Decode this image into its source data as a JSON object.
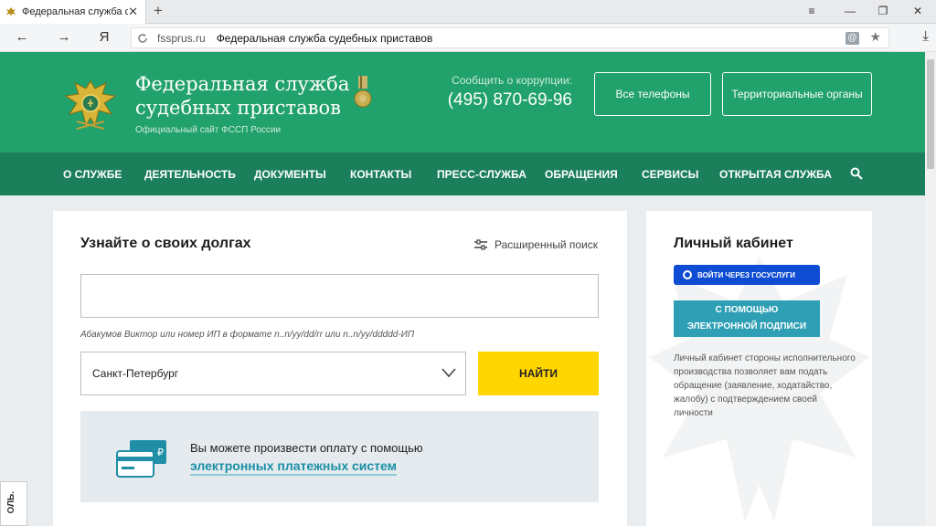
{
  "browser": {
    "tab_title": "Федеральная служба суд",
    "tab_close": "✕",
    "new_tab": "+",
    "back": "←",
    "forward": "→",
    "yandex": "Я",
    "domain": "fssprus.ru",
    "page_title": "Федеральная служба судебных приставов",
    "badge": "@",
    "star": "★",
    "download": "⤓",
    "menu": "≡",
    "minimize": "—",
    "restore": "❐",
    "close": "✕"
  },
  "header": {
    "title": "Федеральная служба судебных приставов",
    "subtitle": "Официальный сайт ФССП России",
    "corruption_label": "Сообщить о коррупции:",
    "corruption_phone": "(495) 870-69-96",
    "btn_phones": "Все телефоны",
    "btn_regions": "Территориальные органы"
  },
  "menu": {
    "items": [
      "О СЛУЖБЕ",
      "ДЕЯТЕЛЬНОСТЬ",
      "ДОКУМЕНТЫ",
      "КОНТАКТЫ",
      "ПРЕСС-СЛУЖБА",
      "ОБРАЩЕНИЯ",
      "СЕРВИСЫ",
      "ОТКРЫТАЯ СЛУЖБА"
    ]
  },
  "debts": {
    "title": "Узнайте о своих долгах",
    "advanced": "Расширенный поиск",
    "search_value": "",
    "hint": "Абакумов Виктор или номер ИП в формате n..n/yy/dd/rr или n..n/yy/ddddd-ИП",
    "region": "Санкт-Петербург",
    "find": "НАЙТИ",
    "pay_text": "Вы можете произвести оплату с помощью",
    "pay_link": "электронных платежных систем",
    "ruble": "₽"
  },
  "cabinet": {
    "title": "Личный кабинет",
    "gosuslugi": "ВОЙТИ ЧЕРЕЗ ГОСУСЛУГИ",
    "esign_line1": "С ПОМОЩЬЮ",
    "esign_line2": "ЭЛЕКТРОННОЙ ПОДПИСИ",
    "text": "Личный кабинет стороны исполнительного производства позволяет вам подать обращение (заявление, ходатайство, жалобу) с подтверждением своей личности"
  },
  "feedback": {
    "label": "ОЛЬ."
  },
  "colors": {
    "header_green": "#21a16b",
    "menu_green": "#1b7f5c",
    "find_yellow": "#ffd600",
    "gosuslugi_blue": "#0d4cd3",
    "esign_teal": "#2e9fb5",
    "link_teal": "#1b8fa6"
  }
}
